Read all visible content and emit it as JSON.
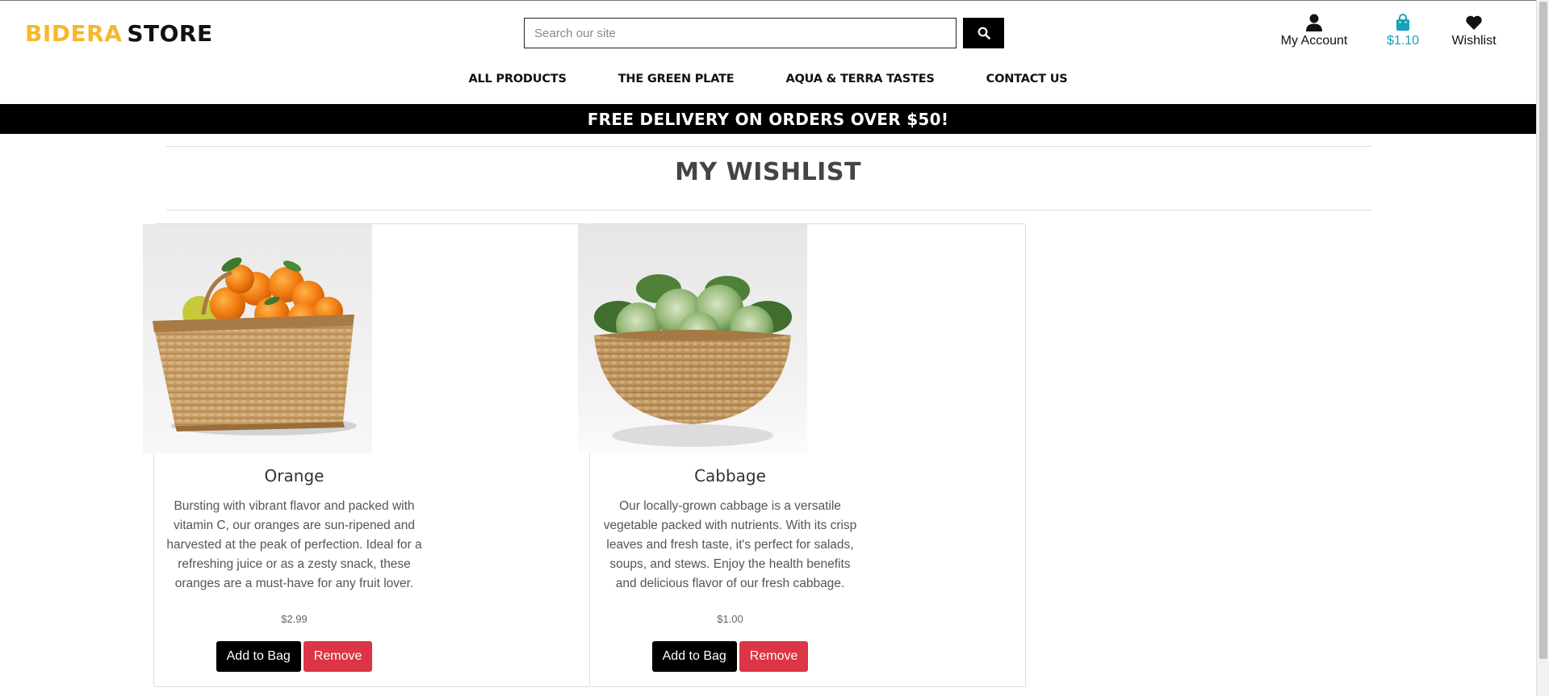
{
  "header": {
    "logo_brand": "BIDERA",
    "logo_store": "STORE",
    "search_placeholder": "Search our site",
    "account_label": "My Account",
    "bag_total": "$1.10",
    "wishlist_label": "Wishlist"
  },
  "nav": {
    "items": [
      {
        "label": "All Products"
      },
      {
        "label": "The Green Plate"
      },
      {
        "label": "Aqua & Terra Tastes"
      },
      {
        "label": "Contact Us"
      }
    ]
  },
  "banner": {
    "text": "Free delivery on orders over $50!"
  },
  "page": {
    "title": "My Wishlist"
  },
  "wishlist": {
    "items": [
      {
        "name": "Orange",
        "description": "Bursting with vibrant flavor and packed with vitamin C, our oranges are sun-ripened and harvested at the peak of perfection. Ideal for a refreshing juice or as a zesty snack, these oranges are a must-have for any fruit lover.",
        "price": "$2.99",
        "add_label": "Add to Bag",
        "remove_label": "Remove"
      },
      {
        "name": "Cabbage",
        "description": "Our locally-grown cabbage is a versatile vegetable packed with nutrients. With its crisp leaves and fresh taste, it's perfect for salads, soups, and stews. Enjoy the health benefits and delicious flavor of our fresh cabbage.",
        "price": "$1.00",
        "add_label": "Add to Bag",
        "remove_label": "Remove"
      }
    ]
  },
  "colors": {
    "brand_yellow": "#f5b82e",
    "bag_teal": "#17a2b8",
    "remove_red": "#dc3545"
  },
  "icons": {
    "search": "search-icon",
    "account": "user-icon",
    "bag": "shopping-bag-icon",
    "wishlist": "heart-icon"
  }
}
